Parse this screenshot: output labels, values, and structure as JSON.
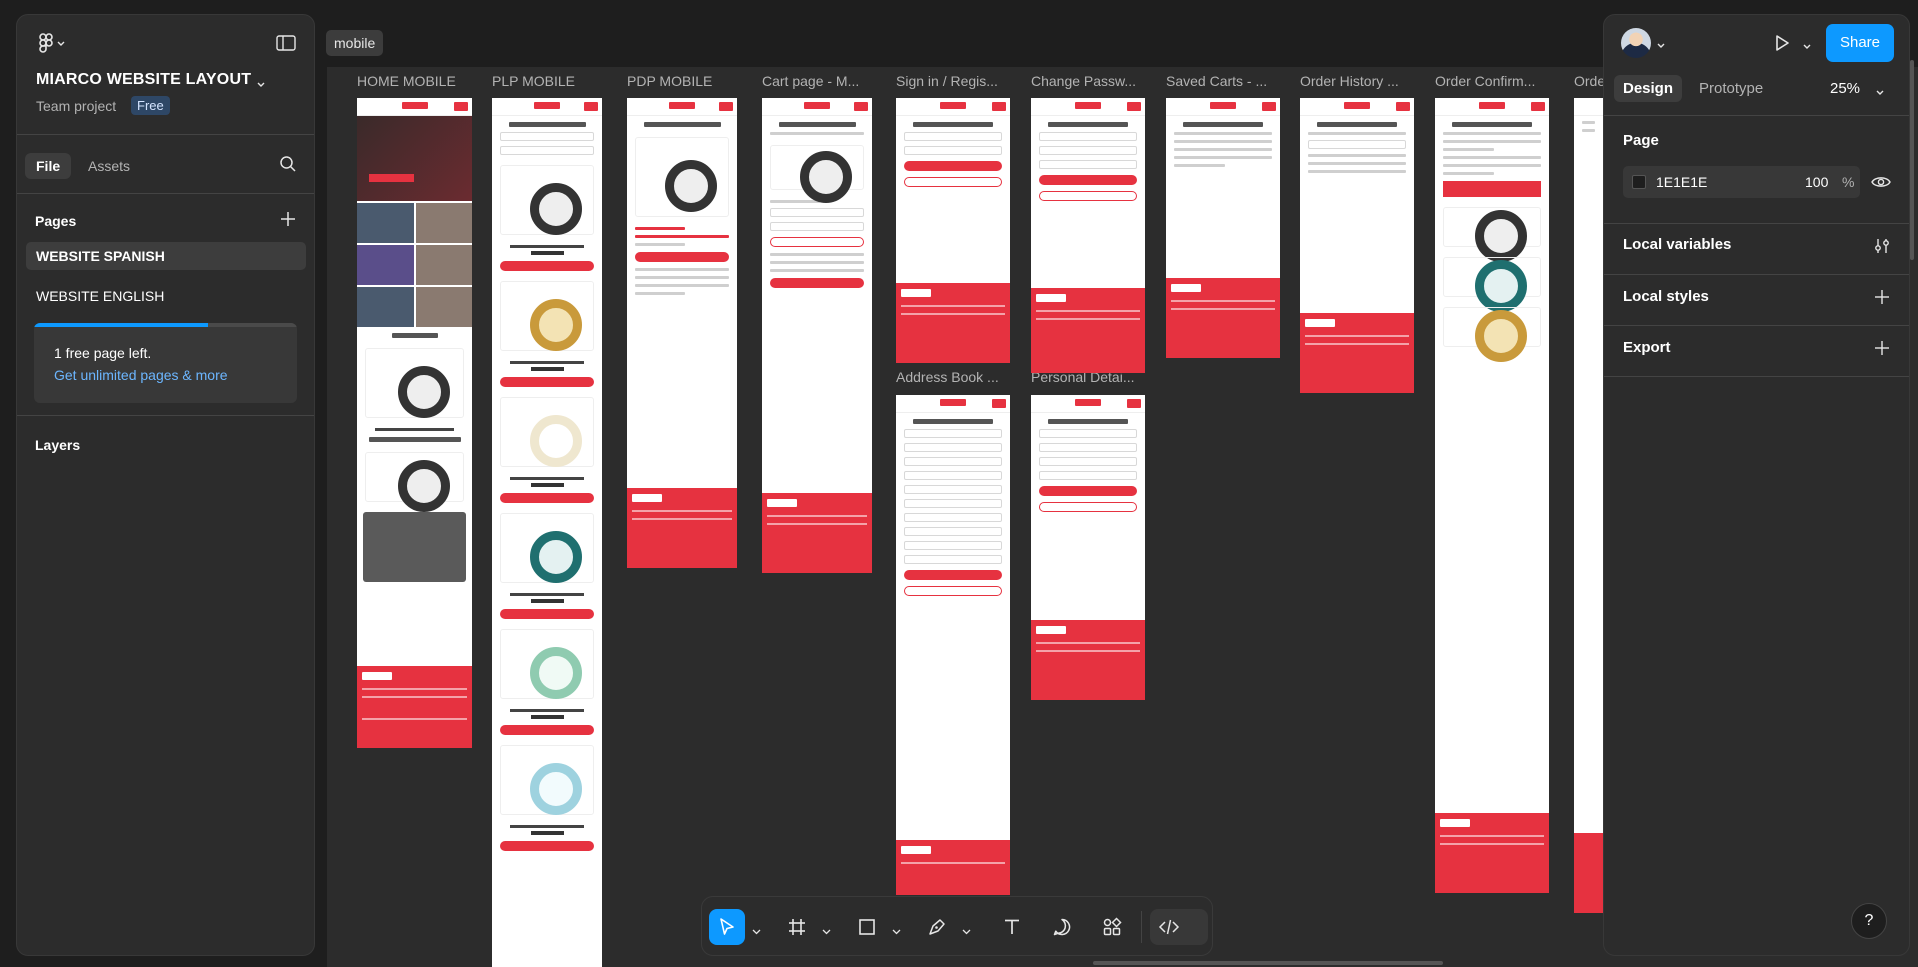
{
  "section": {
    "tag": "mobile"
  },
  "canvas": {
    "frames": [
      {
        "label": "HOME MOBILE",
        "kind": "home"
      },
      {
        "label": "PLP MOBILE",
        "kind": "plp"
      },
      {
        "label": "PDP MOBILE",
        "kind": "pdp"
      },
      {
        "label": "Cart page - M...",
        "kind": "cart"
      },
      {
        "label": "Sign in / Regis...",
        "kind": "form"
      },
      {
        "label": "Change Passw...",
        "kind": "form"
      },
      {
        "label": "Saved Carts - ...",
        "kind": "form"
      },
      {
        "label": "Order History ...",
        "kind": "form"
      },
      {
        "label": "Order Confirm...",
        "kind": "long"
      },
      {
        "label": "Orde",
        "kind": "long"
      },
      {
        "label": "Address Book ...",
        "kind": "form"
      },
      {
        "label": "Personal Detai...",
        "kind": "form"
      }
    ]
  },
  "left_panel": {
    "project_title": "MIARCO WEBSITE LAYOUT",
    "team": "Team project",
    "plan_badge": "Free",
    "tabs": {
      "file": "File",
      "assets": "Assets"
    },
    "pages_heading": "Pages",
    "pages": [
      {
        "name": "WEBSITE SPANISH",
        "active": true
      },
      {
        "name": "WEBSITE ENGLISH",
        "active": false
      }
    ],
    "upgrade": {
      "text": "1 free page left.",
      "link": "Get unlimited pages & more",
      "progress": 0.66
    },
    "layers_heading": "Layers"
  },
  "right_panel": {
    "share": "Share",
    "tabs": {
      "design": "Design",
      "prototype": "Prototype"
    },
    "zoom": "25%",
    "page_heading": "Page",
    "page_color": {
      "hex": "1E1E1E",
      "opacity": "100",
      "unit": "%"
    },
    "sections": {
      "local_variables": "Local variables",
      "local_styles": "Local styles",
      "export": "Export"
    }
  },
  "toolbar": {
    "tools": [
      "move-tool",
      "frame-tool",
      "shape-tool",
      "pen-tool",
      "text-tool",
      "comment-tool",
      "actions-tool"
    ],
    "dev_mode": "dev-mode-toggle"
  },
  "help": "?",
  "colors": {
    "accent": "#0d99ff",
    "brand_red": "#e63240",
    "canvas_bg": "#1e1e1e",
    "panel_bg": "#2c2c2c"
  }
}
